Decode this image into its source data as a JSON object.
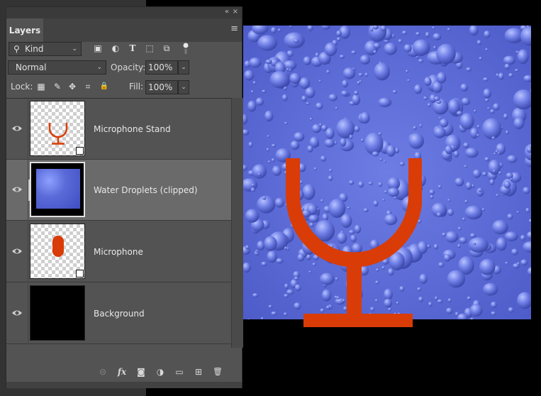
{
  "panel": {
    "collapse_glyph": "«",
    "close_glyph": "×",
    "tab_label": "Layers",
    "menu_glyph": "≡"
  },
  "filter": {
    "search_glyph": "⚲",
    "kind_label": "Kind",
    "icons": [
      "image-filter-icon",
      "adjustment-filter-icon",
      "type-filter-icon",
      "shape-filter-icon",
      "smart-object-filter-icon"
    ],
    "icon_glyphs": [
      "▣",
      "◐",
      "T",
      "⬚",
      "⧉"
    ]
  },
  "blend": {
    "mode": "Normal",
    "opacity_label": "Opacity:",
    "opacity_value": "100%"
  },
  "lock": {
    "label": "Lock:",
    "icons": [
      "lock-transparent-pixels-icon",
      "lock-image-pixels-icon",
      "lock-position-icon",
      "lock-artboard-icon",
      "lock-all-icon"
    ],
    "icon_glyphs": [
      "▦",
      "✎",
      "✥",
      "⌗",
      "🔒"
    ],
    "fill_label": "Fill:",
    "fill_value": "100%"
  },
  "layers": [
    {
      "name": "Microphone Stand",
      "selected": false,
      "thumb": "stand",
      "smart": true
    },
    {
      "name": "Water Droplets (clipped)",
      "selected": true,
      "thumb": "water",
      "smart": false
    },
    {
      "name": "Microphone",
      "selected": false,
      "thumb": "mic",
      "smart": true
    },
    {
      "name": "Background",
      "selected": false,
      "thumb": "black",
      "smart": false
    }
  ],
  "bottom_icons": [
    "link-layers-icon",
    "fx-icon",
    "add-mask-icon",
    "new-adjustment-icon",
    "new-group-icon",
    "new-layer-icon",
    "delete-layer-icon"
  ],
  "bottom_glyphs": [
    "⊝",
    "fx",
    "◙",
    "◑",
    "▭",
    "⊞",
    "🗑"
  ],
  "colors": {
    "accent_red": "#d93c06",
    "water_blue": "#5a6ad8"
  }
}
